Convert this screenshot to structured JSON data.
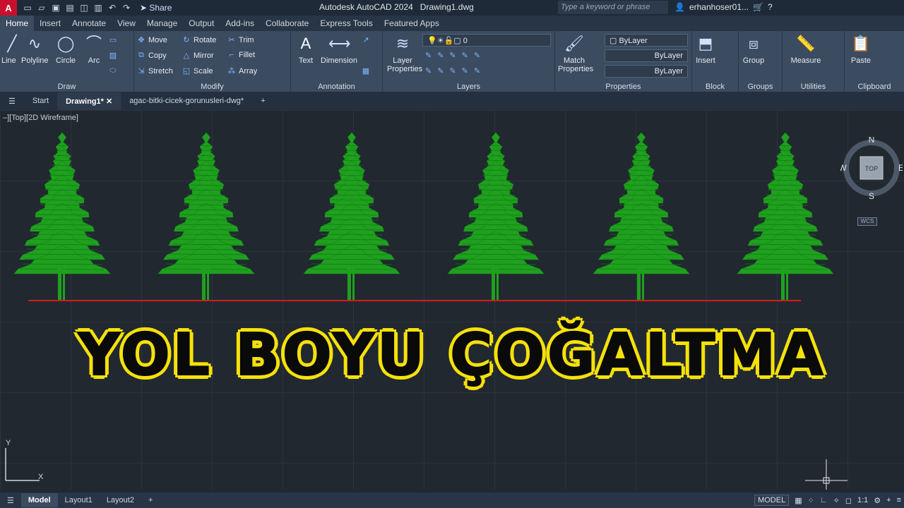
{
  "app": {
    "logo": "A",
    "title": "Autodesk AutoCAD 2024",
    "document": "Drawing1.dwg",
    "share": "Share",
    "search_placeholder": "Type a keyword or phrase",
    "user": "erhanhoser01..."
  },
  "ribbon_tabs": [
    "Home",
    "Insert",
    "Annotate",
    "View",
    "Manage",
    "Output",
    "Add-ins",
    "Collaborate",
    "Express Tools",
    "Featured Apps"
  ],
  "panels": {
    "draw": {
      "title": "Draw",
      "line": "Line",
      "polyline": "Polyline",
      "circle": "Circle",
      "arc": "Arc"
    },
    "modify": {
      "title": "Modify",
      "move": "Move",
      "rotate": "Rotate",
      "trim": "Trim",
      "copy": "Copy",
      "mirror": "Mirror",
      "fillet": "Fillet",
      "stretch": "Stretch",
      "scale": "Scale",
      "array": "Array"
    },
    "annotation": {
      "title": "Annotation",
      "text": "Text",
      "dimension": "Dimension"
    },
    "layers": {
      "title": "Layers",
      "layer_properties_1": "Layer",
      "layer_properties_2": "Properties",
      "current_layer": "0"
    },
    "properties": {
      "title": "Properties",
      "match_1": "Match",
      "match_2": "Properties",
      "color": "ByLayer",
      "linetype": "ByLayer",
      "lineweight": "ByLayer"
    },
    "block": {
      "title": "Block",
      "insert": "Insert"
    },
    "groups": {
      "title": "Groups",
      "group": "Group"
    },
    "utilities": {
      "title": "Utilities",
      "measure": "Measure"
    },
    "clipboard": {
      "title": "Clipboard",
      "paste": "Paste"
    }
  },
  "file_tabs": {
    "start": "Start",
    "drawing": "Drawing1*",
    "other": "agac-bitki-cicek-gorunusleri-dwg*"
  },
  "viewport": {
    "control": "–][Top][2D Wireframe]",
    "caption": "YOL BOYU ÇOĞALTMA",
    "compass": {
      "n": "N",
      "s": "S",
      "e": "E",
      "w": "W",
      "top": "TOP"
    },
    "wcs": "WCS",
    "ucs_x": "X",
    "ucs_y": "Y"
  },
  "colors": {
    "tree": "#1fa01f",
    "road": "#d81b1b",
    "caption_fill": "#0a0a0a",
    "caption_outline": "#f5e10a"
  },
  "layout_tabs": [
    "Model",
    "Layout1",
    "Layout2"
  ],
  "status": {
    "model": "MODEL",
    "scale": "1:1"
  }
}
